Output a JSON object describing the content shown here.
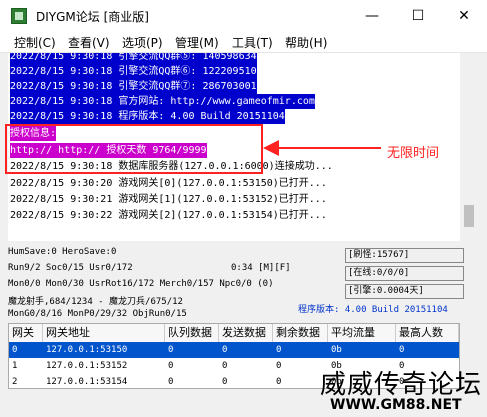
{
  "window": {
    "title": "DIYGM论坛 [商业版]",
    "controls": {
      "minimize": "—",
      "maximize": "☐",
      "close": "✕"
    }
  },
  "menu": [
    "控制(C)",
    "查看(V)",
    "选项(P)",
    "管理(M)",
    "工具(T)",
    "帮助(H)"
  ],
  "log": [
    {
      "text": "2022/8/15 9:30:18 引擎交流QQ群⑤: 140598634",
      "style": "sel"
    },
    {
      "text": "2022/8/15 9:30:18 引擎交流QQ群⑥: 122209510",
      "style": "sel"
    },
    {
      "text": "2022/8/15 9:30:18 引擎交流QQ群⑦: 286703001",
      "style": "sel"
    },
    {
      "text": "2022/8/15 9:30:18 官方网站: http://www.gameofmir.com",
      "style": "sel"
    },
    {
      "text": "2022/8/15 9:30:18 程序版本: 4.00 Build 20151104",
      "style": "sel"
    },
    {
      "text": "授权信息:",
      "style": "selm"
    },
    {
      "text": "http:// http:// 授权天数 9764/9999",
      "style": "selm"
    },
    {
      "text": "2022/8/15 9:30:18 数据库服务器(127.0.0.1:6000)连接成功...",
      "style": "plain"
    },
    {
      "text": "2022/8/15 9:30:20 游戏网关[0](127.0.0.1:53150)已打开...",
      "style": "plain"
    },
    {
      "text": "2022/8/15 9:30:21 游戏网关[1](127.0.0.1:53152)已打开...",
      "style": "plain"
    },
    {
      "text": "2022/8/15 9:30:22 游戏网关[2](127.0.0.1:53154)已打开...",
      "style": "plain"
    }
  ],
  "annotation": {
    "label": "无限时间"
  },
  "status": {
    "line1": "HumSave:0 HeroSave:0",
    "line2": "Run9/2 Soc0/15 Usr0/172",
    "timer": "0:34 [M][F]",
    "line3": "Mon0/0 Mon0/30 UsrRot16/172 Merch0/157 Npc0/0 (0)",
    "line4": "魔龙射手,684/1234 - 魔龙刀兵/675/12",
    "line5": "MonG0/8/16 MonP0/29/32 ObjRun0/15",
    "box_refresh": "[刷怪:15767]",
    "box_online": "[在线:0/0/0]",
    "box_engine": "[引擎:0.0004天]",
    "version": "程序版本: 4.00 Build 20151104"
  },
  "gateway_table": {
    "headers": [
      "网关",
      "网关地址",
      "队列数据",
      "发送数据",
      "剩余数据",
      "平均流量",
      "最高人数"
    ],
    "rows": [
      [
        "0",
        "127.0.0.1:53150",
        "0",
        "0",
        "0",
        "0b",
        "0"
      ],
      [
        "1",
        "127.0.0.1:53152",
        "0",
        "0",
        "0",
        "0b",
        "0"
      ],
      [
        "2",
        "127.0.0.1:53154",
        "0",
        "0",
        "0",
        "0b",
        "0"
      ]
    ]
  },
  "watermark": {
    "line1": "威威传奇论坛",
    "line2": "WWW.GM88.NET"
  }
}
